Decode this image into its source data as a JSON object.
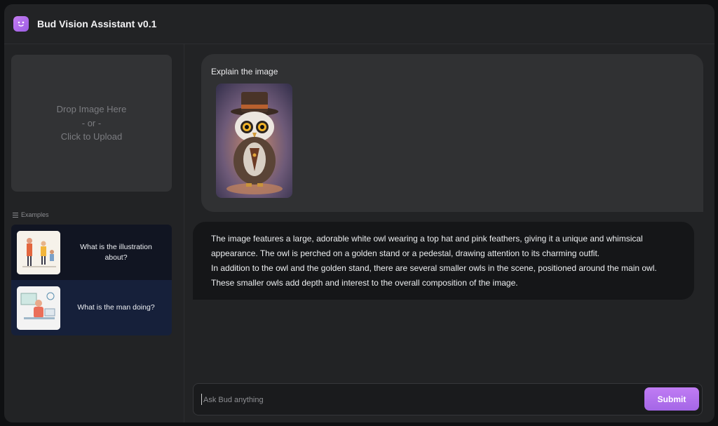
{
  "app": {
    "title": "Bud Vision Assistant v0.1",
    "logo_icon": "smiley-face-icon",
    "accent": "#b46ff0"
  },
  "upload": {
    "line1": "Drop Image Here",
    "line2": "- or -",
    "line3": "Click to Upload"
  },
  "examples": {
    "heading": "Examples",
    "items": [
      {
        "label": "What is the illustration about?"
      },
      {
        "label": "What is the man doing?"
      }
    ]
  },
  "chat": {
    "user_prompt": "Explain the image",
    "assistant_lines": [
      "The image features a large, adorable white owl wearing a top hat and pink feathers, giving it a unique and whimsical appearance. The owl is perched on a golden stand or a pedestal, drawing attention to its charming outfit.",
      "In addition to the owl and the golden stand, there are several smaller owls in the scene, positioned around the main owl. These smaller owls add depth and interest to the overall composition of the image."
    ]
  },
  "input": {
    "placeholder": "Ask Bud anything",
    "submit_label": "Submit"
  }
}
